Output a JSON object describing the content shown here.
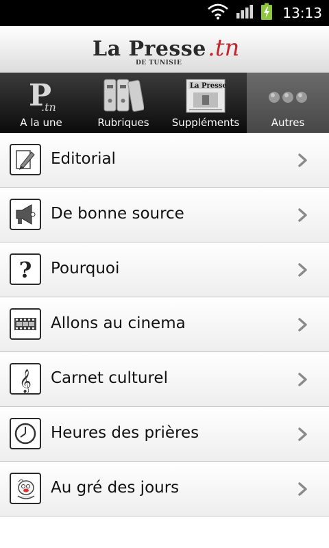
{
  "status_bar": {
    "time": "13:13",
    "icons": [
      "wifi-icon",
      "signal-icon",
      "battery-charging-icon"
    ]
  },
  "header": {
    "logo_main": "La Presse",
    "logo_suffix": ".tn",
    "logo_sub": "DE TUNISIE"
  },
  "tabs": [
    {
      "label": "A la une",
      "icon": "la-presse-p-logo-icon",
      "selected": false
    },
    {
      "label": "Rubriques",
      "icon": "binders-icon",
      "selected": false
    },
    {
      "label": "Suppléments",
      "icon": "newspaper-icon",
      "selected": false
    },
    {
      "label": "Autres",
      "icon": "more-dots-icon",
      "selected": true
    }
  ],
  "list": [
    {
      "label": "Editorial",
      "icon": "pen-icon"
    },
    {
      "label": "De bonne source",
      "icon": "megaphone-icon"
    },
    {
      "label": "Pourquoi",
      "icon": "question-icon"
    },
    {
      "label": "Allons au cinema",
      "icon": "film-icon"
    },
    {
      "label": "Carnet culturel",
      "icon": "treble-clef-icon"
    },
    {
      "label": "Heures des prières",
      "icon": "clock-icon"
    },
    {
      "label": "Au gré des jours",
      "icon": "cartoon-character-icon"
    }
  ],
  "colors": {
    "brand_red": "#c1272d",
    "tab_bar_dark": "#0b0b0b",
    "tab_selected": "#5a5a5a",
    "battery_green": "#8ec63f"
  }
}
